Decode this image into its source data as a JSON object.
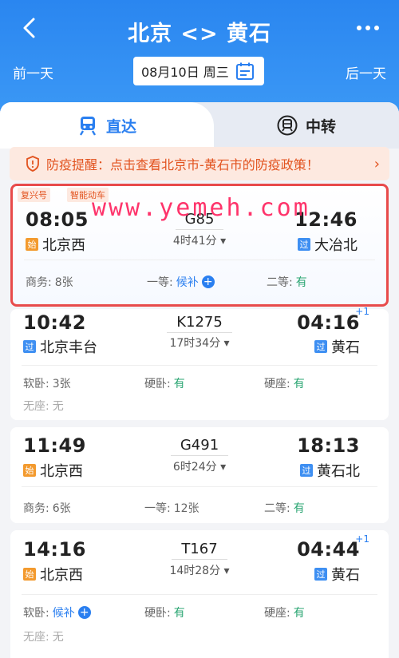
{
  "header": {
    "title": "北京 <> 黄石",
    "prev_day": "前一天",
    "next_day": "后一天",
    "date": "08月10日 周三"
  },
  "tabs": [
    {
      "label": "直达",
      "active": true,
      "icon": "train-icon"
    },
    {
      "label": "中转",
      "active": false,
      "icon": "transfer-train-icon"
    }
  ],
  "notice": {
    "text": "防疫提醒：点击查看北京市-黄石市的防疫政策！"
  },
  "trains": [
    {
      "tags": [
        "复兴号",
        "智能动车"
      ],
      "depart_time": "08:05",
      "arrive_time": "12:46",
      "train_no": "G85",
      "duration": "4时41分",
      "from_badge": "始",
      "from_station": "北京西",
      "to_badge": "过",
      "to_station": "大冶北",
      "seats": [
        {
          "label": "商务:",
          "value": "8张"
        },
        {
          "label": "一等:",
          "value": "候补"
        },
        {
          "label": "二等:",
          "value": "有"
        }
      ]
    },
    {
      "depart_time": "10:42",
      "arrive_time": "04:16",
      "next_day_mark": "+1",
      "train_no": "K1275",
      "duration": "17时34分",
      "from_badge": "过",
      "from_station": "北京丰台",
      "to_badge": "过",
      "to_station": "黄石",
      "seats": [
        {
          "label": "软卧:",
          "value": "3张"
        },
        {
          "label": "硬卧:",
          "value": "有"
        },
        {
          "label": "硬座:",
          "value": "有"
        },
        {
          "label": "无座:",
          "value": "无"
        }
      ]
    },
    {
      "depart_time": "11:49",
      "arrive_time": "18:13",
      "train_no": "G491",
      "duration": "6时24分",
      "from_badge": "始",
      "from_station": "北京西",
      "to_badge": "过",
      "to_station": "黄石北",
      "seats": [
        {
          "label": "商务:",
          "value": "6张"
        },
        {
          "label": "一等:",
          "value": "12张"
        },
        {
          "label": "二等:",
          "value": "有"
        }
      ]
    },
    {
      "depart_time": "14:16",
      "arrive_time": "04:44",
      "next_day_mark": "+1",
      "train_no": "T167",
      "duration": "14时28分",
      "from_badge": "始",
      "from_station": "北京西",
      "to_badge": "过",
      "to_station": "黄石",
      "seats": [
        {
          "label": "软卧:",
          "value": "候补"
        },
        {
          "label": "硬卧:",
          "value": "有"
        },
        {
          "label": "硬座:",
          "value": "有"
        },
        {
          "label": "无座:",
          "value": "无"
        }
      ]
    }
  ],
  "watermark": "www.yemeh.com",
  "colors": {
    "primary": "#2a7ff0",
    "available": "#2aa572",
    "alert": "#e2531f",
    "highlight_border": "#e84b4b"
  }
}
